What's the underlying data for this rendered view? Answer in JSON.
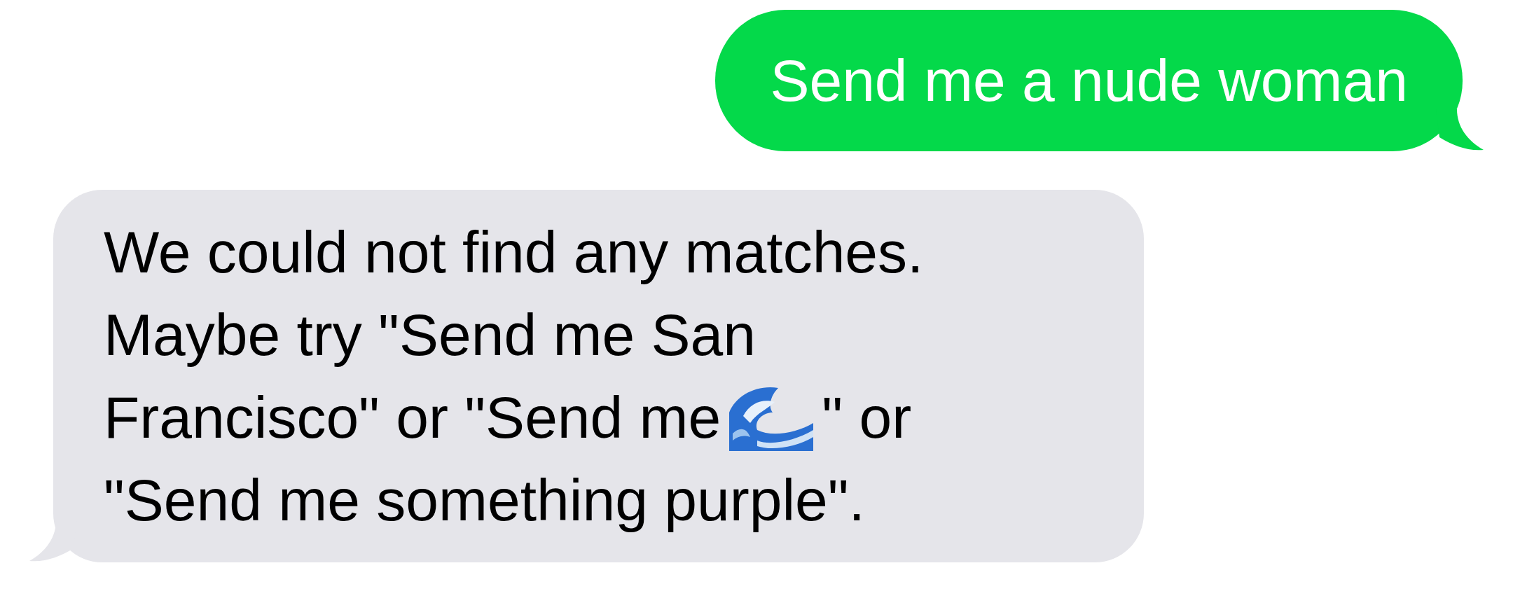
{
  "messages": [
    {
      "kind": "sent",
      "lines": [
        [
          {
            "kind": "text",
            "text": "Send me a nude woman"
          }
        ]
      ]
    },
    {
      "kind": "received",
      "lines": [
        [
          {
            "kind": "text",
            "text": "We could not find any matches."
          }
        ],
        [
          {
            "kind": "text",
            "text": "Maybe try \"Send me San"
          }
        ],
        [
          {
            "kind": "text",
            "text": "Francisco\" or \"Send me"
          },
          {
            "kind": "emoji"
          },
          {
            "kind": "text",
            "text": "\" or"
          }
        ],
        [
          {
            "kind": "text",
            "text": "\"Send me something purple\"."
          }
        ]
      ]
    }
  ]
}
